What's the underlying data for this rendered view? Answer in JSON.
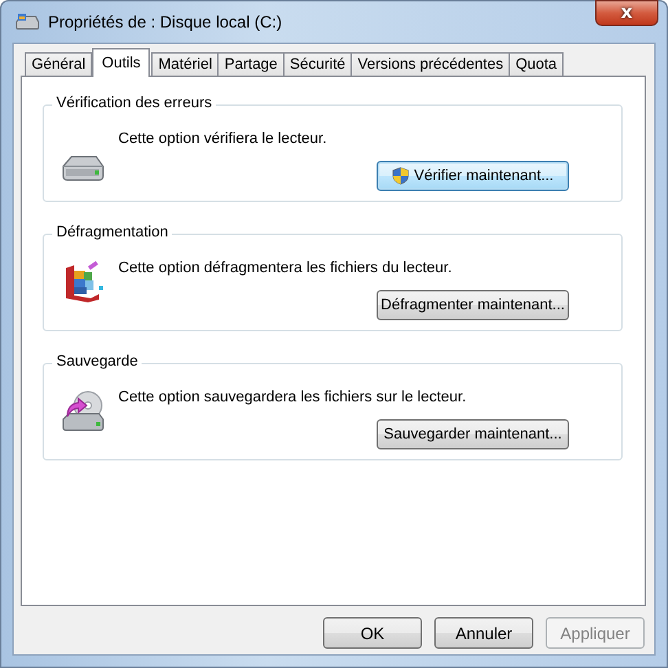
{
  "window": {
    "title": "Propriétés de : Disque local (C:)",
    "close": "x"
  },
  "tabs": [
    {
      "label": "Général",
      "selected": false
    },
    {
      "label": "Outils",
      "selected": true
    },
    {
      "label": "Matériel",
      "selected": false
    },
    {
      "label": "Partage",
      "selected": false
    },
    {
      "label": "Sécurité",
      "selected": false
    },
    {
      "label": "Versions précédentes",
      "selected": false
    },
    {
      "label": "Quota",
      "selected": false
    }
  ],
  "sections": [
    {
      "kind": "check",
      "title": "Vérification des erreurs",
      "text": "Cette option vérifiera le lecteur.",
      "button": "Vérifier maintenant...",
      "focused": true,
      "shield": true
    },
    {
      "kind": "defrag",
      "title": "Défragmentation",
      "text": "Cette option défragmentera les fichiers du lecteur.",
      "button": "Défragmenter maintenant...",
      "focused": false,
      "shield": false
    },
    {
      "kind": "backup",
      "title": "Sauvegarde",
      "text": "Cette option sauvegardera les fichiers sur le lecteur.",
      "button": "Sauvegarder maintenant...",
      "focused": false,
      "shield": false
    }
  ],
  "buttons": [
    {
      "label": "OK",
      "disabled": false
    },
    {
      "label": "Annuler",
      "disabled": false
    },
    {
      "label": "Appliquer",
      "disabled": true
    }
  ]
}
